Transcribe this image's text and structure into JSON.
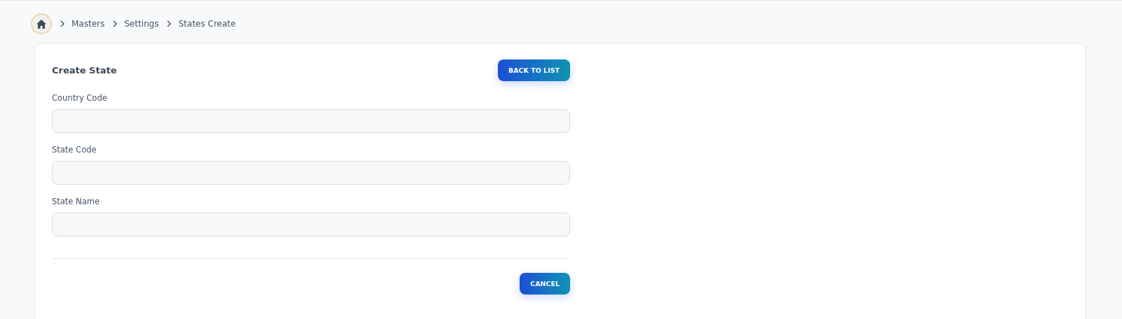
{
  "breadcrumb": [
    "Masters",
    "Settings",
    "States Create"
  ],
  "card": {
    "title": "Create State",
    "back_button": "BACK TO LIST",
    "fields": [
      {
        "label": "Country Code"
      },
      {
        "label": "State Code"
      },
      {
        "label": "State Name"
      }
    ],
    "cancel_button": "CANCEL"
  }
}
